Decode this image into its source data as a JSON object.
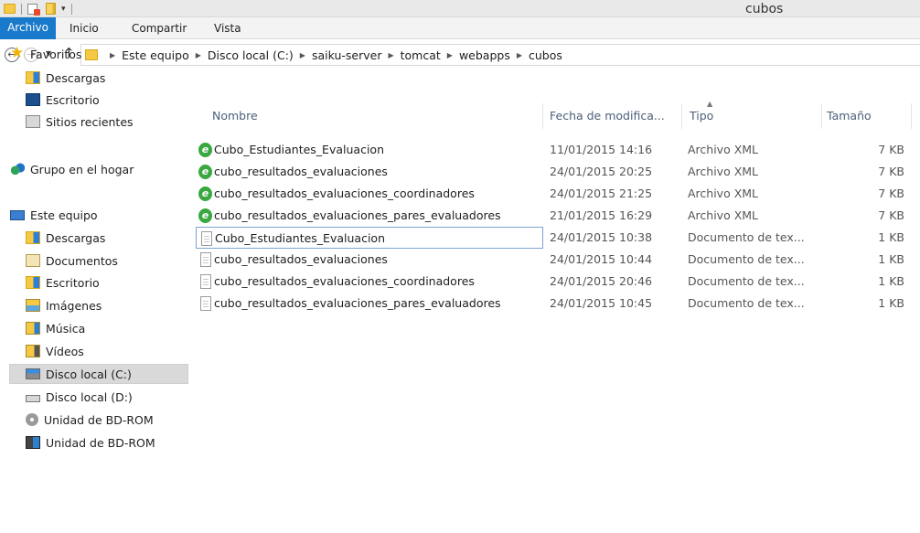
{
  "window": {
    "title": "cubos"
  },
  "ribbon": {
    "file": "Archivo",
    "tabs": [
      "Inicio",
      "Compartir",
      "Vista"
    ]
  },
  "address": {
    "crumbs": [
      "Este equipo",
      "Disco local (C:)",
      "saiku-server",
      "tomcat",
      "webapps",
      "cubos"
    ]
  },
  "nav": {
    "favorites": {
      "label": "Favoritos",
      "items": [
        "Descargas",
        "Escritorio",
        "Sitios recientes"
      ]
    },
    "homegroup": "Grupo en el hogar",
    "pc": {
      "label": "Este equipo",
      "items": [
        "Descargas",
        "Documentos",
        "Escritorio",
        "Imágenes",
        "Música",
        "Vídeos",
        "Disco local (C:)",
        "Disco local (D:)",
        "Unidad de BD-ROM",
        "Unidad de BD-ROM"
      ]
    },
    "selected": "Disco local (C:)"
  },
  "columns": {
    "name": "Nombre",
    "date": "Fecha de modifica...",
    "type": "Tipo",
    "size": "Tamaño"
  },
  "files": [
    {
      "name": "Cubo_Estudiantes_Evaluacion",
      "date": "11/01/2015 14:16",
      "type": "Archivo XML",
      "size": "7 KB",
      "icon": "xml-file-icon"
    },
    {
      "name": "cubo_resultados_evaluaciones",
      "date": "24/01/2015 20:25",
      "type": "Archivo XML",
      "size": "7 KB",
      "icon": "xml-file-icon"
    },
    {
      "name": "cubo_resultados_evaluaciones_coordinadores",
      "date": "24/01/2015 21:25",
      "type": "Archivo XML",
      "size": "7 KB",
      "icon": "xml-file-icon"
    },
    {
      "name": "cubo_resultados_evaluaciones_pares_evaluadores",
      "date": "21/01/2015 16:29",
      "type": "Archivo XML",
      "size": "7 KB",
      "icon": "xml-file-icon"
    },
    {
      "name": "Cubo_Estudiantes_Evaluacion",
      "date": "24/01/2015 10:38",
      "type": "Documento de tex...",
      "size": "1 KB",
      "icon": "text-file-icon"
    },
    {
      "name": "cubo_resultados_evaluaciones",
      "date": "24/01/2015 10:44",
      "type": "Documento de tex...",
      "size": "1 KB",
      "icon": "text-file-icon"
    },
    {
      "name": "cubo_resultados_evaluaciones_coordinadores",
      "date": "24/01/2015 20:46",
      "type": "Documento de tex...",
      "size": "1 KB",
      "icon": "text-file-icon"
    },
    {
      "name": "cubo_resultados_evaluaciones_pares_evaluadores",
      "date": "24/01/2015 10:45",
      "type": "Documento de tex...",
      "size": "1 KB",
      "icon": "text-file-icon"
    }
  ],
  "focused_row": 4,
  "colors": {
    "file_tab": "#1979ca",
    "selection": "#d9d9d9",
    "focus_border": "#7da2ce",
    "header_text": "#4c607a"
  }
}
